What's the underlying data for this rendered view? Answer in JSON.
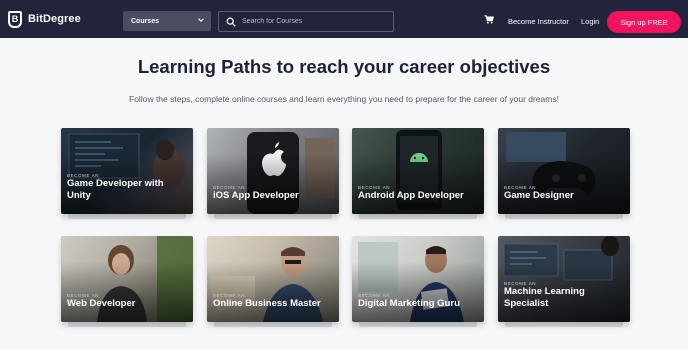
{
  "nav": {
    "brand": "BitDegree",
    "brand_mark": "B",
    "courses_label": "Courses",
    "search_placeholder": "Search for Courses",
    "become_instructor": "Become Instructor",
    "login": "Login",
    "signup": "Sign up FREE"
  },
  "hero": {
    "title": "Learning Paths to reach your career objectives",
    "subtitle": "Follow the steps, complete online courses and learn everything you need to prepare for the career of your dreams!"
  },
  "cards": [
    {
      "kicker": "Become an",
      "title_line1": "Game Developer with",
      "title_line2": "Unity"
    },
    {
      "kicker": "Become an",
      "title_line1": "iOS App Developer",
      "title_line2": ""
    },
    {
      "kicker": "Become an",
      "title_line1": "Android App Developer",
      "title_line2": ""
    },
    {
      "kicker": "Become an",
      "title_line1": "Game Designer",
      "title_line2": ""
    },
    {
      "kicker": "Become an",
      "title_line1": "Web Developer",
      "title_line2": ""
    },
    {
      "kicker": "Become an",
      "title_line1": "Online Business Master",
      "title_line2": ""
    },
    {
      "kicker": "Become an",
      "title_line1": "Digital Marketing Guru",
      "title_line2": ""
    },
    {
      "kicker": "Become an",
      "title_line1": "Machine Learning",
      "title_line2": "Specialist"
    }
  ],
  "colors": {
    "nav_bg": "#21243a",
    "accent": "#f0145e",
    "heading": "#1e2238"
  }
}
